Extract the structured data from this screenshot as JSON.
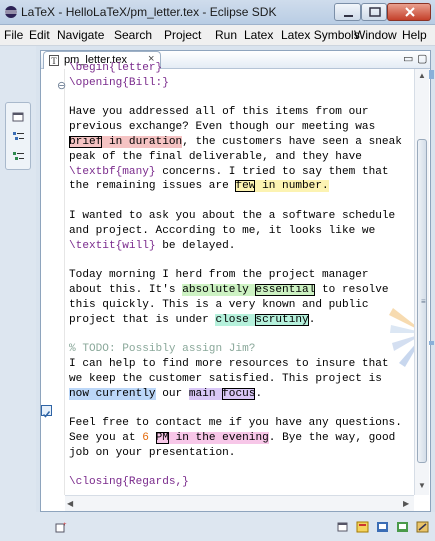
{
  "window": {
    "title": "LaTeX - HelloLaTeX/pm_letter.tex - Eclipse SDK",
    "app_icon": "eclipse-icon",
    "controls": [
      "minimize-icon",
      "maximize-icon",
      "close-icon"
    ]
  },
  "menu": [
    "File",
    "Edit",
    "Navigate",
    "Search",
    "Project",
    "Run",
    "Latex",
    "Latex Symbols",
    "Window",
    "Help"
  ],
  "editor": {
    "tab": {
      "label": "pm_letter.tex",
      "icon": "tex-file-icon",
      "close": "×"
    },
    "view_min": "▭",
    "view_max": "▢",
    "fold_marker": "⊖",
    "lines": [
      [
        {
          "t": "\\begin{letter}",
          "c": "cmd"
        }
      ],
      [
        {
          "t": "\\opening{Bill:}",
          "c": "cmd"
        }
      ],
      [
        {
          "t": ""
        }
      ],
      [
        {
          "t": "Have you addressed all of this items from our"
        }
      ],
      [
        {
          "t": "previous exchange? Even though our meeting was"
        }
      ],
      [
        {
          "t": "brief",
          "c": "hl-red box"
        },
        {
          "t": " in duration",
          "c": "hl-red"
        },
        {
          "t": ", the customers have seen a sneak"
        }
      ],
      [
        {
          "t": "peak of the final deliverable, and they have"
        }
      ],
      [
        {
          "t": "\\textbf{many}",
          "c": "cmd"
        },
        {
          "t": " concerns. I tried to say them that"
        }
      ],
      [
        {
          "t": "the remaining issues are "
        },
        {
          "t": "few",
          "c": "hl-yel box"
        },
        {
          "t": " in number.",
          "c": "hl-yel"
        }
      ],
      [
        {
          "t": ""
        }
      ],
      [
        {
          "t": "I wanted to ask you about the a software schedule"
        }
      ],
      [
        {
          "t": "and project. According to me, it looks like we"
        }
      ],
      [
        {
          "t": "\\textit{will}",
          "c": "cmd"
        },
        {
          "t": " be delayed."
        }
      ],
      [
        {
          "t": ""
        }
      ],
      [
        {
          "t": "Today morning I herd from the project manager"
        }
      ],
      [
        {
          "t": "about this. It's "
        },
        {
          "t": "absolutely ",
          "c": "hl-grn"
        },
        {
          "t": "essential",
          "c": "hl-grn box"
        },
        {
          "t": " to resolve"
        }
      ],
      [
        {
          "t": "this quickly. This is a very known and public"
        }
      ],
      [
        {
          "t": "project that is under "
        },
        {
          "t": "close ",
          "c": "hl-cyan"
        },
        {
          "t": "scrutiny",
          "c": "hl-cyan box"
        },
        {
          "t": "."
        }
      ],
      [
        {
          "t": ""
        }
      ],
      [
        {
          "t": "% TODO: Possibly assign Jim?",
          "c": "cmt"
        }
      ],
      [
        {
          "t": "I can help to find more resources to insure that"
        }
      ],
      [
        {
          "t": "we keep the customer satisfied. This project is"
        }
      ],
      [
        {
          "t": "now currently",
          "c": "hl-blue"
        },
        {
          "t": " our "
        },
        {
          "t": "main ",
          "c": "hl-pur"
        },
        {
          "t": "focus",
          "c": "hl-pur box"
        },
        {
          "t": "."
        }
      ],
      [
        {
          "t": ""
        }
      ],
      [
        {
          "t": "Feel free to contact me if you have any questions."
        }
      ],
      [
        {
          "t": "See you at "
        },
        {
          "t": "6",
          "c": "num"
        },
        {
          "t": " "
        },
        {
          "t": "PM",
          "c": "hl-pink box"
        },
        {
          "t": " in the evening",
          "c": "hl-pink"
        },
        {
          "t": ". Bye the way, good"
        }
      ],
      [
        {
          "t": "job on your presentation."
        }
      ],
      [
        {
          "t": ""
        }
      ],
      [
        {
          "t": "\\closing{Regards,}",
          "c": "cmd"
        }
      ]
    ]
  },
  "left_trim_icons": [
    "perspective-icon",
    "outline-icon",
    "structure-icon"
  ],
  "status_icons": [
    "fast-view-icon",
    "pin-icon",
    "latex-perspective-icon",
    "java-perspective-icon",
    "debug-perspective-icon",
    "cvs-perspective-icon"
  ],
  "colors": {
    "accent": "#3b6db5",
    "comment": "#8aa89a",
    "command": "#7a2a8c",
    "number": "#e46a0a"
  }
}
